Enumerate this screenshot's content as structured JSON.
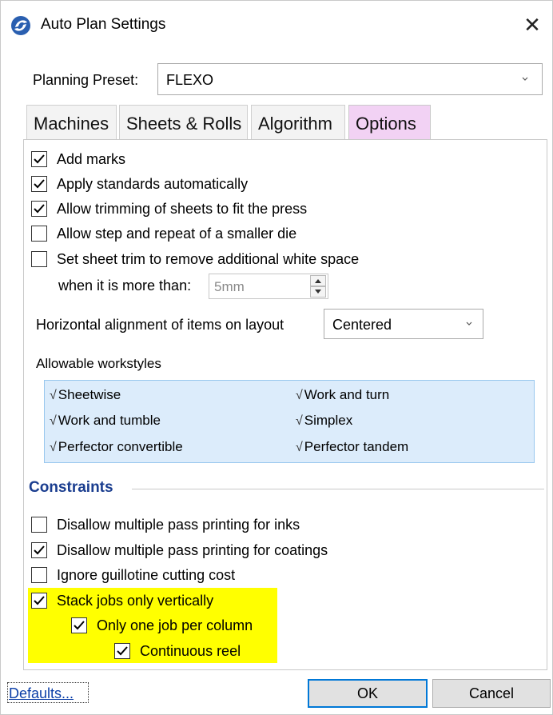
{
  "window": {
    "title": "Auto Plan Settings",
    "close_glyph": "✕",
    "icon": "app-logo-icon",
    "accent": "#0078d7"
  },
  "preset": {
    "label": "Planning Preset:",
    "value": "FLEXO"
  },
  "tabs": [
    {
      "label": "Machines",
      "active": false
    },
    {
      "label": "Sheets & Rolls",
      "active": false
    },
    {
      "label": "Algorithm",
      "active": false
    },
    {
      "label": "Options",
      "active": true
    }
  ],
  "options": {
    "add_marks": {
      "label": "Add marks",
      "checked": true
    },
    "apply_standards": {
      "label": "Apply standards automatically",
      "checked": true
    },
    "allow_trimming": {
      "label": "Allow trimming of sheets to fit the press",
      "checked": true
    },
    "allow_step_repeat": {
      "label": "Allow step and repeat of a smaller die",
      "checked": false
    },
    "set_sheet_trim": {
      "label": "Set sheet trim to remove additional white space",
      "checked": false
    },
    "trim_threshold": {
      "label": "when it is more than:",
      "placeholder": "5mm"
    },
    "horizontal_alignment": {
      "label": "Horizontal alignment of items on layout",
      "value": "Centered"
    },
    "workstyles": {
      "label": "Allowable workstyles",
      "check_glyph": "√",
      "items": [
        "Sheetwise",
        "Work and turn",
        "Work and tumble",
        "Simplex",
        "Perfector convertible",
        "Perfector tandem"
      ]
    }
  },
  "constraints": {
    "title": "Constraints",
    "items": [
      {
        "label": "Disallow multiple pass printing for inks",
        "checked": false
      },
      {
        "label": "Disallow multiple pass printing for coatings",
        "checked": true
      },
      {
        "label": "Ignore guillotine cutting cost",
        "checked": false
      },
      {
        "label": "Stack jobs only vertically",
        "checked": true
      },
      {
        "label": "Only one job per column",
        "checked": true
      },
      {
        "label": "Continuous reel",
        "checked": true
      }
    ],
    "highlight_color": "#ffff00"
  },
  "footer": {
    "defaults_label": "Defaults...",
    "ok_label": "OK",
    "cancel_label": "Cancel"
  }
}
